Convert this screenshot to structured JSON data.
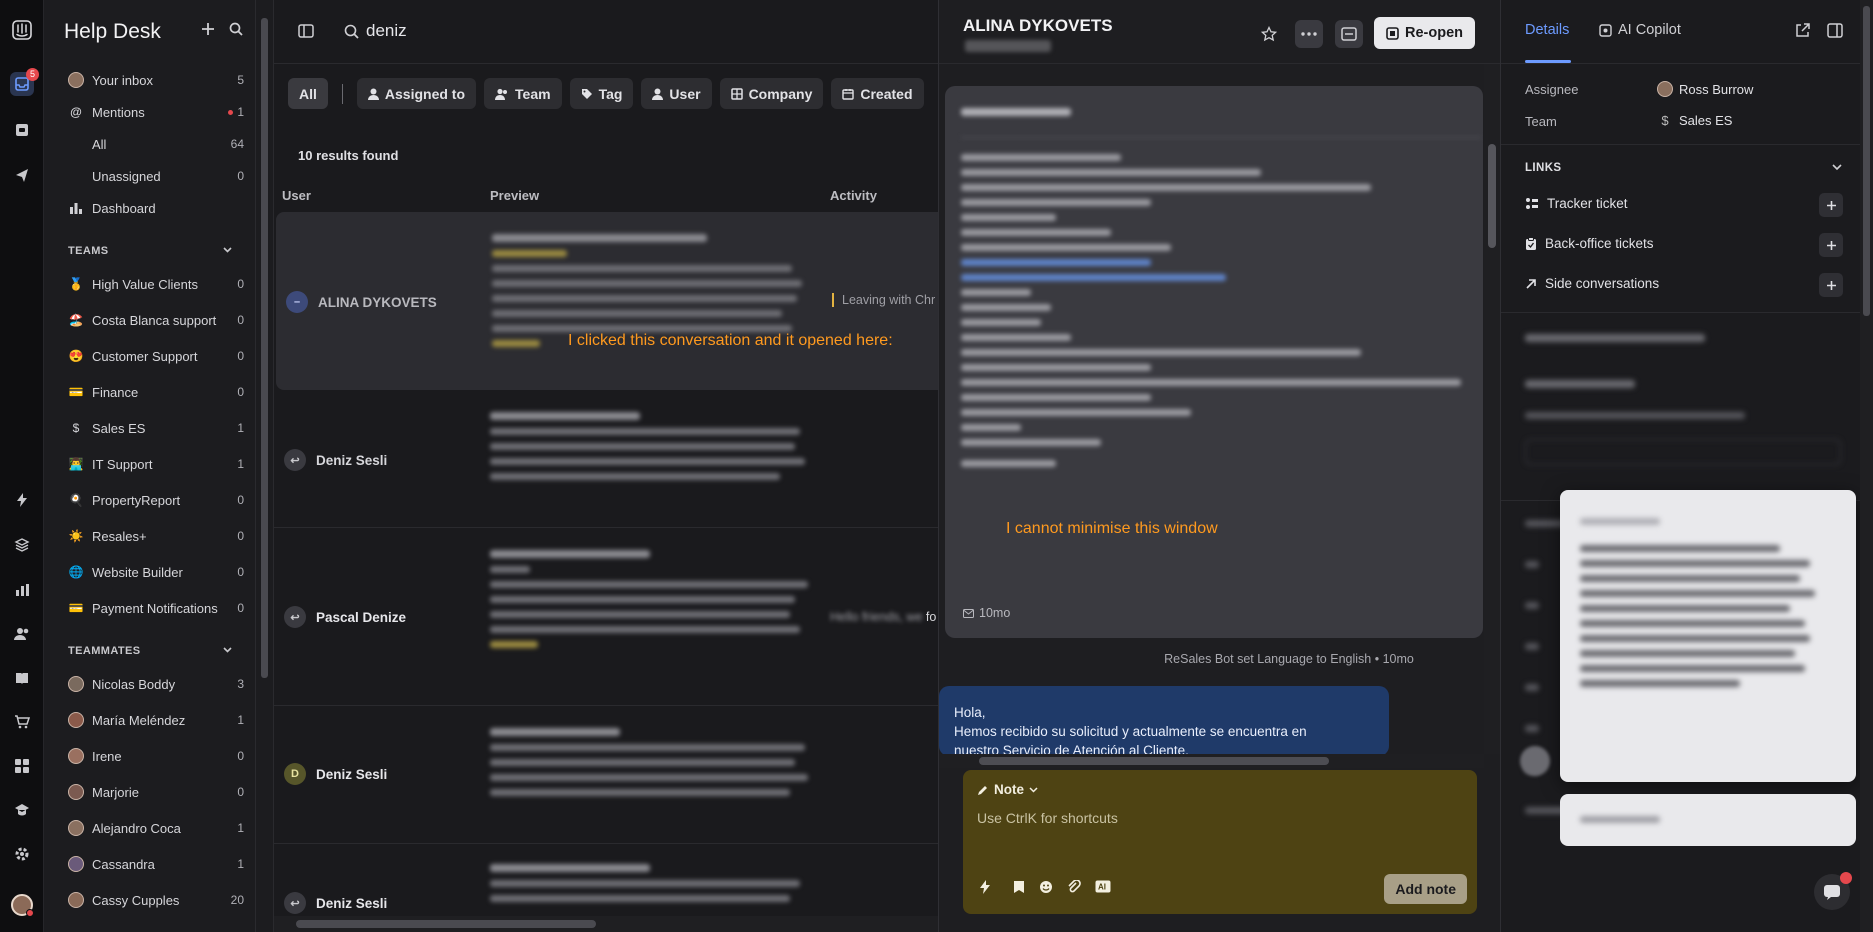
{
  "rail": {
    "inbox_badge": "5"
  },
  "sidebar": {
    "title": "Help Desk",
    "items": [
      {
        "label": "Your inbox",
        "count": "5",
        "icon": "avatar"
      },
      {
        "label": "Mentions",
        "count": "1",
        "icon": "at-icon"
      },
      {
        "label": "All",
        "count": "64",
        "icon": "inbox-icon"
      },
      {
        "label": "Unassigned",
        "count": "0",
        "icon": "inbox-icon"
      },
      {
        "label": "Dashboard",
        "count": "",
        "icon": "chart-icon"
      }
    ],
    "teams_heading": "TEAMS",
    "teams": [
      {
        "label": "High Value Clients",
        "count": "0",
        "emoji": "🥇"
      },
      {
        "label": "Costa Blanca support",
        "count": "0",
        "emoji": "🏖️"
      },
      {
        "label": "Customer Support",
        "count": "0",
        "emoji": "😍"
      },
      {
        "label": "Finance",
        "count": "0",
        "emoji": "💳"
      },
      {
        "label": "Sales ES",
        "count": "1",
        "emoji": "$"
      },
      {
        "label": "IT Support",
        "count": "1",
        "emoji": "👨‍💻"
      },
      {
        "label": "PropertyReport",
        "count": "0",
        "emoji": "🍳"
      },
      {
        "label": "Resales+",
        "count": "0",
        "emoji": "☀️"
      },
      {
        "label": "Website Builder",
        "count": "0",
        "emoji": "🌐"
      },
      {
        "label": "Payment Notifications",
        "count": "0",
        "emoji": "💳"
      }
    ],
    "teammates_heading": "TEAMMATES",
    "teammates": [
      {
        "label": "Nicolas Boddy",
        "count": "3"
      },
      {
        "label": "María Meléndez",
        "count": "1"
      },
      {
        "label": "Irene",
        "count": "0"
      },
      {
        "label": "Marjorie",
        "count": "0"
      },
      {
        "label": "Alejandro Coca",
        "count": "1"
      },
      {
        "label": "Cassandra",
        "count": "1"
      },
      {
        "label": "Cassy Cupples",
        "count": "20"
      }
    ]
  },
  "search": {
    "query": "deniz"
  },
  "filters": {
    "all": "All",
    "chips": [
      "Assigned to",
      "Team",
      "Tag",
      "User",
      "Company",
      "Created"
    ]
  },
  "results": {
    "count_text": "10 results found",
    "col_user": "User",
    "col_preview": "Preview",
    "col_activity": "Activity",
    "rows": [
      {
        "user": "ALINA DYKOVETS",
        "avatar": "–",
        "activity": "Leaving with Chr"
      },
      {
        "user": "Deniz Sesli",
        "avatar": "↩",
        "activity": ""
      },
      {
        "user": "Pascal Denize",
        "avatar": "↩",
        "activity": "fo"
      },
      {
        "user": "Deniz Sesli",
        "avatar": "D",
        "activity": ""
      },
      {
        "user": "Deniz Sesli",
        "avatar": "↩",
        "activity": ""
      }
    ]
  },
  "annotations": {
    "list_note": "I clicked this conversation and it opened here:",
    "conv_note": "I cannot minimise this window"
  },
  "conversation": {
    "title": "ALINA DYKOVETS",
    "reopen_label": "Re-open",
    "msg_time": "10mo",
    "system_event": "ReSales Bot set Language to English",
    "system_event_time": "10mo",
    "bot_message_line1": "Hola,",
    "bot_message_line2": "Hemos recibido su solicitud y actualmente se encuentra en",
    "bot_message_line3": "nuestro Servicio de Atención al Cliente.",
    "composer_mode": "Note",
    "composer_placeholder": "Use Ctrl",
    "composer_placeholder_key": "K",
    "composer_placeholder_rest": " for shortcuts",
    "add_note_label": "Add note"
  },
  "details": {
    "tab_details": "Details",
    "tab_copilot": "AI Copilot",
    "assignee_label": "Assignee",
    "assignee_value": "Ross Burrow",
    "team_label": "Team",
    "team_value": "Sales ES",
    "links_heading": "LINKS",
    "links": [
      "Tracker ticket",
      "Back-office tickets",
      "Side conversations"
    ]
  },
  "colors": {
    "accent": "#6d9bff",
    "annotation": "#ff9a1f",
    "composer_bg": "#4e4313",
    "bot_bubble": "#1f3a69"
  }
}
